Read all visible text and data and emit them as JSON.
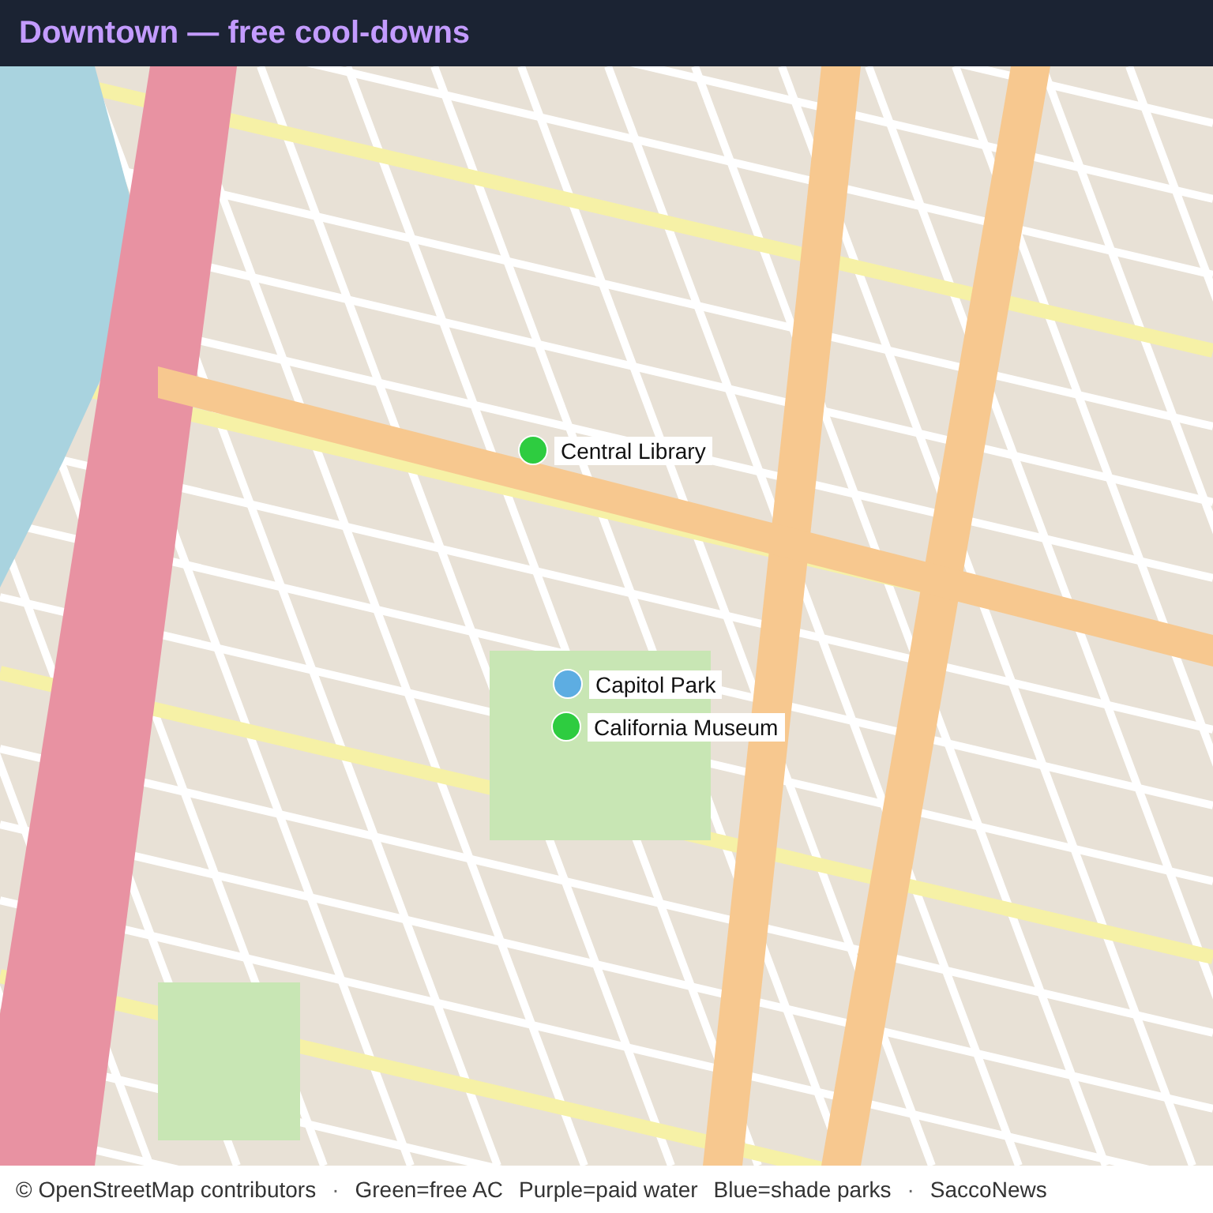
{
  "header": {
    "title": "Downtown — free cool-downs"
  },
  "markers": [
    {
      "label": "Central Library",
      "color": "#2ecc40"
    },
    {
      "label": "Capitol Park",
      "color": "#5dade2"
    },
    {
      "label": "California Museum",
      "color": "#2ecc40"
    }
  ],
  "footer": {
    "attribution": "© OpenStreetMap contributors",
    "separator_1": "·",
    "legend": [
      "Green=free AC",
      "Purple=paid water",
      "Blue=shade parks"
    ],
    "separator_2": "·",
    "source": "SaccoNews"
  }
}
